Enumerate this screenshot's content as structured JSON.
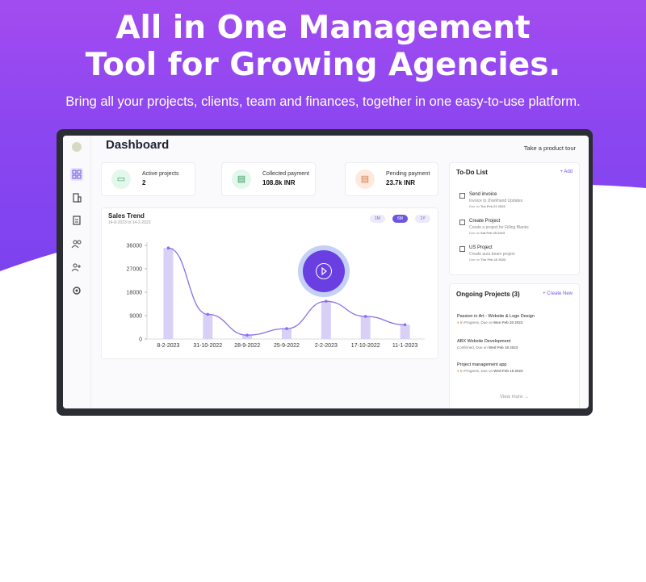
{
  "hero": {
    "title_line1": "All in One Management",
    "title_line2": "Tool for Growing Agencies.",
    "subtitle": "Bring all your projects, clients, team and finances, together in one easy-to-use platform."
  },
  "dashboard": {
    "title": "Dashboard",
    "tour_link": "Take a product tour",
    "sidebar_icons": [
      "logo",
      "grid-icon",
      "building-icon",
      "document-icon",
      "users-icon",
      "user-plus-icon",
      "settings-icon"
    ]
  },
  "stats": [
    {
      "label": "Active projects",
      "value": "2",
      "icon": "layout-icon",
      "color": "#e4f7ec"
    },
    {
      "label": "Collected payment",
      "value": "108.8k INR",
      "icon": "card-icon",
      "color": "#e4f7ec"
    },
    {
      "label": "Pending payment",
      "value": "23.7k INR",
      "icon": "card-icon",
      "color": "#fde9dd"
    }
  ],
  "sales": {
    "title": "Sales Trend",
    "date_range": "14-8-2023 to 14-2-2023",
    "ranges": [
      "1M",
      "6M",
      "1Y"
    ],
    "active_range": "6M"
  },
  "chart_data": {
    "type": "bar",
    "title": "Sales Trend",
    "categories": [
      "8-2-2023",
      "31-10-2022",
      "28-9-2022",
      "25-9-2022",
      "2-2-2023",
      "17-10-2022",
      "11-1-2023"
    ],
    "values": [
      35000,
      9500,
      1500,
      4000,
      14500,
      8700,
      5500
    ],
    "line_values": [
      35000,
      9500,
      1500,
      4000,
      14500,
      8700,
      5500
    ],
    "yticks": [
      "36000",
      "27000",
      "18000",
      "9000",
      "0"
    ],
    "ylim": [
      0,
      36000
    ]
  },
  "todo": {
    "title": "To-Do List",
    "add_label": "+ Add",
    "items": [
      {
        "title": "Send invoice",
        "desc": "Invoice to Jharkhand Updates",
        "due_label": "Due on",
        "due": "Tue Feb 21 2023"
      },
      {
        "title": "Create Project",
        "desc": "Create a project for Filling Blanks",
        "due_label": "Due on",
        "due": "Sat Feb 25 2023"
      },
      {
        "title": "US Project",
        "desc": "Create aura beam project",
        "due_label": "Due on",
        "due": "Thu Feb 16 2023"
      }
    ]
  },
  "projects": {
    "title": "Ongoing Projects (3)",
    "create_label": "+ Create New",
    "items": [
      {
        "name": "Passion in Art - Website & Logo Design",
        "status": "In Progress, Due on",
        "due": "Mon Feb 20 2023"
      },
      {
        "name": "ABX Website Development",
        "status": "Confirmed, Due on",
        "due": "Wed Feb 15 2023"
      },
      {
        "name": "Project management app",
        "status": "In Progress, Due on",
        "due": "Wed Feb 15 2023"
      }
    ],
    "view_more": "View more →"
  }
}
